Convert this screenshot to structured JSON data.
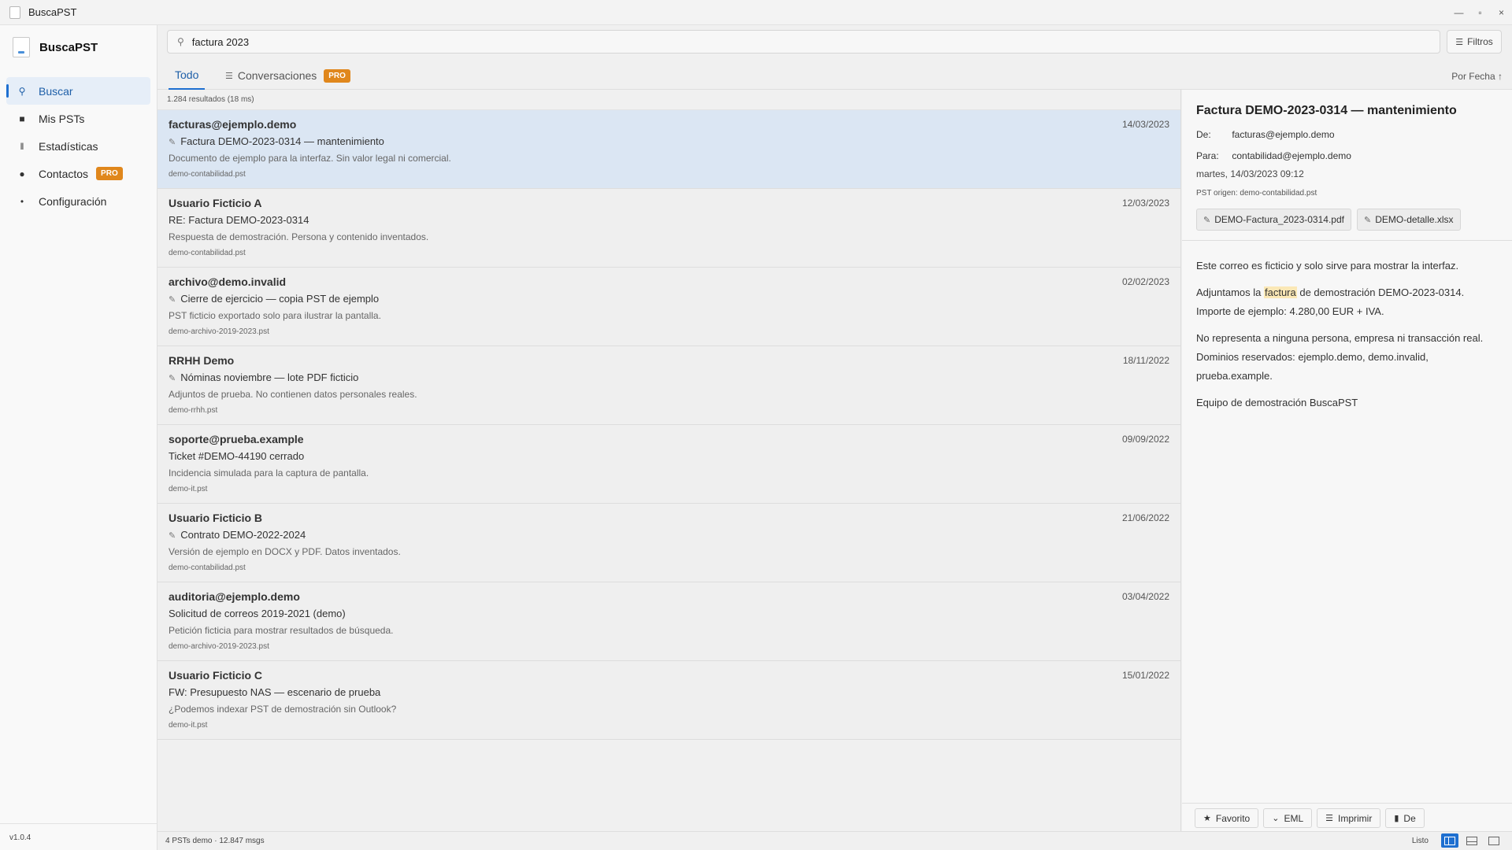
{
  "window": {
    "title": "BuscaPST",
    "controls": [
      "—",
      "▫",
      "×"
    ]
  },
  "sidebar": {
    "brand": "BuscaPST",
    "items": [
      {
        "label": "Buscar",
        "icon": "search-icon",
        "glyph": "⚲",
        "active": true
      },
      {
        "label": "Mis PSTs",
        "icon": "folder-icon",
        "glyph": "■"
      },
      {
        "label": "Estadísticas",
        "icon": "bar-chart-icon",
        "glyph": "ǁ"
      },
      {
        "label": "Contactos",
        "icon": "person-icon",
        "glyph": "●",
        "badge": "PRO"
      },
      {
        "label": "Configuración",
        "icon": "gear-icon",
        "glyph": "•"
      }
    ],
    "version": "v1.0.4"
  },
  "search": {
    "value": "factura 2023",
    "filters_label": "Filtros"
  },
  "tabs": [
    {
      "label": "Todo",
      "active": true
    },
    {
      "label": "Conversaciones",
      "badge": "PRO"
    }
  ],
  "sort_label": "Por Fecha ↑",
  "results": {
    "count_text": "1.284 resultados (18 ms)",
    "rows": [
      {
        "sender": "facturas@ejemplo.demo",
        "date": "14/03/2023",
        "subject": "Factura DEMO-2023-0314 — mantenimiento",
        "attachment": true,
        "preview": "Documento de ejemplo para la interfaz. Sin valor legal ni comercial.",
        "source": "demo-contabilidad.pst",
        "selected": true
      },
      {
        "sender": "Usuario Ficticio A",
        "date": "12/03/2023",
        "subject": "RE: Factura DEMO-2023-0314",
        "attachment": false,
        "preview": "Respuesta de demostración. Persona y contenido inventados.",
        "source": "demo-contabilidad.pst"
      },
      {
        "sender": "archivo@demo.invalid",
        "date": "02/02/2023",
        "subject": "Cierre de ejercicio — copia PST de ejemplo",
        "attachment": true,
        "preview": "PST ficticio exportado solo para ilustrar la pantalla.",
        "source": "demo-archivo-2019-2023.pst"
      },
      {
        "sender": "RRHH Demo",
        "date": "18/11/2022",
        "subject": "Nóminas noviembre — lote PDF ficticio",
        "attachment": true,
        "preview": "Adjuntos de prueba. No contienen datos personales reales.",
        "source": "demo-rrhh.pst"
      },
      {
        "sender": "soporte@prueba.example",
        "date": "09/09/2022",
        "subject": "Ticket #DEMO-44190 cerrado",
        "attachment": false,
        "preview": "Incidencia simulada para la captura de pantalla.",
        "source": "demo-it.pst"
      },
      {
        "sender": "Usuario Ficticio B",
        "date": "21/06/2022",
        "subject": "Contrato DEMO-2022-2024",
        "attachment": true,
        "preview": "Versión de ejemplo en DOCX y PDF. Datos inventados.",
        "source": "demo-contabilidad.pst"
      },
      {
        "sender": "auditoria@ejemplo.demo",
        "date": "03/04/2022",
        "subject": "Solicitud de correos 2019-2021 (demo)",
        "attachment": false,
        "preview": "Petición ficticia para mostrar resultados de búsqueda.",
        "source": "demo-archivo-2019-2023.pst"
      },
      {
        "sender": "Usuario Ficticio C",
        "date": "15/01/2022",
        "subject": "FW: Presupuesto NAS — escenario de prueba",
        "attachment": false,
        "preview": "¿Podemos indexar PST de demostración sin Outlook?",
        "source": "demo-it.pst"
      }
    ]
  },
  "reader": {
    "title": "Factura DEMO-2023-0314 — mantenimiento",
    "from_label": "De:",
    "from": "facturas@ejemplo.demo",
    "to_label": "Para:",
    "to": "contabilidad@ejemplo.demo",
    "date": "martes, 14/03/2023 09:12",
    "origin": "PST origen: demo-contabilidad.pst",
    "attachments": [
      "DEMO-Factura_2023-0314.pdf",
      "DEMO-detalle.xlsx"
    ],
    "body": {
      "p1": "Este correo es ficticio y solo sirve para mostrar la interfaz.",
      "p2_before": "Adjuntamos la ",
      "p2_highlight": "factura",
      "p2_after": " de demostración DEMO-2023-0314. Importe de ejemplo: 4.280,00 EUR + IVA.",
      "p3": "No representa a ninguna persona, empresa ni transacción real. Dominios reservados: ejemplo.demo, demo.invalid, prueba.example.",
      "p4": "Equipo de demostración BuscaPST"
    },
    "actions": [
      {
        "label": "Favorito",
        "icon": "star-icon",
        "glyph": "★"
      },
      {
        "label": "EML",
        "icon": "download-icon",
        "glyph": "⌄"
      },
      {
        "label": "Imprimir",
        "icon": "print-icon",
        "glyph": "☰"
      },
      {
        "label": "De",
        "icon": "trash-icon",
        "glyph": "▮"
      }
    ]
  },
  "status": {
    "left": "4 PSTs demo · 12.847 msgs",
    "ready": "Listo"
  },
  "colors": {
    "accent": "#1e6fd0",
    "pro_badge": "#e0871c",
    "selected_row": "#dbe6f3",
    "highlight": "#fbe8b6"
  }
}
